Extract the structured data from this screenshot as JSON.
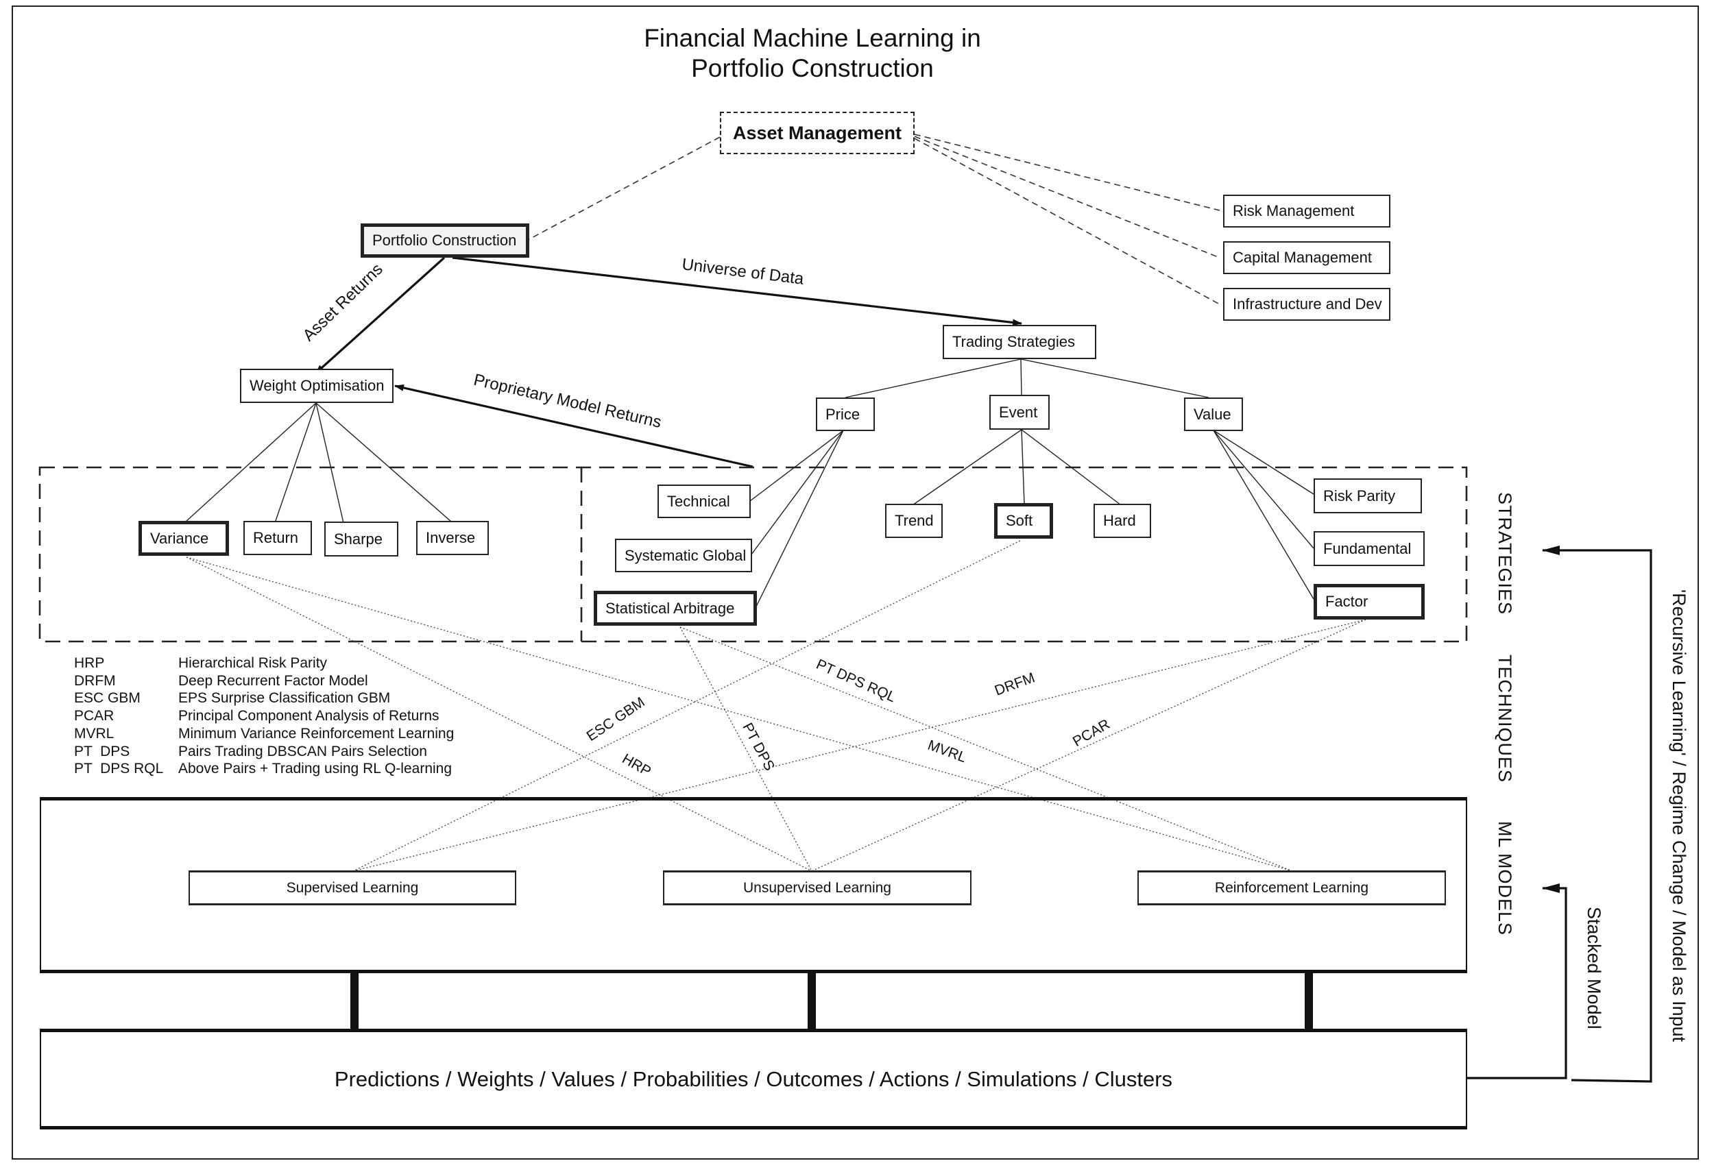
{
  "title": {
    "line1": "Financial Machine Learning in",
    "line2": "Portfolio Construction"
  },
  "nodes": {
    "asset_management": "Asset Management",
    "portfolio_construction": "Portfolio Construction",
    "risk_management": "Risk Management",
    "capital_management": "Capital Management",
    "infrastructure_dev": "Infrastructure and Dev",
    "weight_optimisation": "Weight Optimisation",
    "trading_strategies": "Trading Strategies",
    "price": "Price",
    "event": "Event",
    "value": "Value",
    "variance": "Variance",
    "return": "Return",
    "sharpe": "Sharpe",
    "inverse": "Inverse",
    "technical": "Technical",
    "systematic_global": "Systematic Global",
    "statistical_arbitrage": "Statistical Arbitrage",
    "trend": "Trend",
    "soft": "Soft",
    "hard": "Hard",
    "risk_parity": "Risk Parity",
    "fundamental": "Fundamental",
    "factor": "Factor"
  },
  "edge_labels": {
    "asset_returns": "Asset Returns",
    "universe_of_data": "Universe of Data",
    "proprietary_model_returns": "Proprietary Model Returns"
  },
  "techniques": {
    "hrp": "HRP",
    "mvrl": "MVRL",
    "esc_gbm": "ESC GBM",
    "pt_dps": "PT DPS",
    "pt_dps_rql": "PT DPS RQL",
    "drfm": "DRFM",
    "pcar": "PCAR"
  },
  "legend": [
    {
      "abbr": "HRP",
      "full": "Hierarchical Risk Parity"
    },
    {
      "abbr": "DRFM",
      "full": "Deep Recurrent Factor Model"
    },
    {
      "abbr": "ESC GBM",
      "full": "EPS Surprise Classification GBM"
    },
    {
      "abbr": "PCAR",
      "full": "Principal Component Analysis of Returns"
    },
    {
      "abbr": "MVRL",
      "full": "Minimum Variance Reinforcement Learning"
    },
    {
      "abbr": "PT  DPS",
      "full": "Pairs Trading DBSCAN Pairs Selection"
    },
    {
      "abbr": "PT  DPS RQL",
      "full": "Above Pairs + Trading using RL Q-learning"
    }
  ],
  "ml_models": {
    "supervised": "Supervised Learning",
    "unsupervised": "Unsupervised Learning",
    "reinforcement": "Reinforcement Learning"
  },
  "outputs": "Predictions / Weights / Values / Probabilities / Outcomes / Actions / Simulations / Clusters",
  "bands": {
    "strategies": "STRATEGIES",
    "techniques": "TECHNIQUES",
    "ml_models": "ML MODELS"
  },
  "feedback": {
    "stacked_model": "Stacked Model",
    "recursive": "'Recursive Learning' / Regime Change  / Model as Input"
  }
}
